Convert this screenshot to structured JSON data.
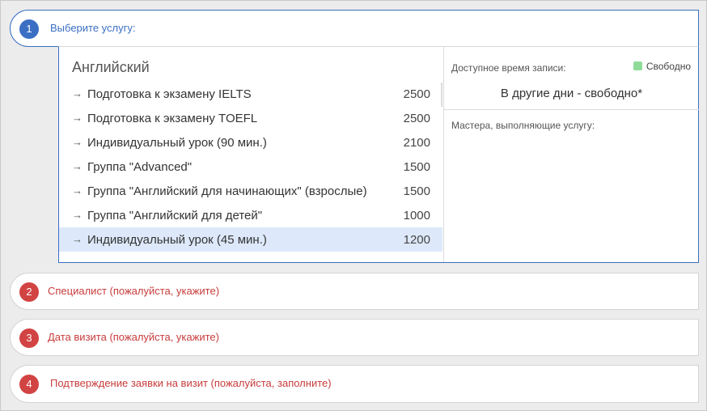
{
  "steps": [
    {
      "number": "1",
      "title": "Выберите услугу:"
    },
    {
      "number": "2",
      "title": "Специалист (пожалуйста, укажите)"
    },
    {
      "number": "3",
      "title": "Дата визита (пожалуйста, укажите)"
    },
    {
      "number": "4",
      "title": "Подтверждение заявки на визит (пожалуйста, заполните)"
    }
  ],
  "services": {
    "category": "Английский",
    "arrow": "→",
    "items": [
      {
        "name": "Подготовка к экзамену IELTS",
        "price": "2500"
      },
      {
        "name": "Подготовка к экзамену TOEFL",
        "price": "2500"
      },
      {
        "name": "Индивидуальный урок (90 мин.)",
        "price": "2100"
      },
      {
        "name": "Группа \"Advanced\"",
        "price": "1500"
      },
      {
        "name": "Группа \"Английский для начинающих\" (взрослые)",
        "price": "1500"
      },
      {
        "name": "Группа \"Английский для детей\"",
        "price": "1000"
      },
      {
        "name": "Индивидуальный урок (45 мин.)",
        "price": "1200",
        "selected": true
      }
    ]
  },
  "availability": {
    "label": "Доступное время записи:",
    "legend_free": "Свободно",
    "legend_color": "#8fdc9a",
    "other_days": "В другие дни - свободно*",
    "masters_label": "Мастера, выполняющие услугу:"
  },
  "colors": {
    "active": "#3b6fc4",
    "pending": "#d24343",
    "selected_row": "#dde9fa"
  }
}
